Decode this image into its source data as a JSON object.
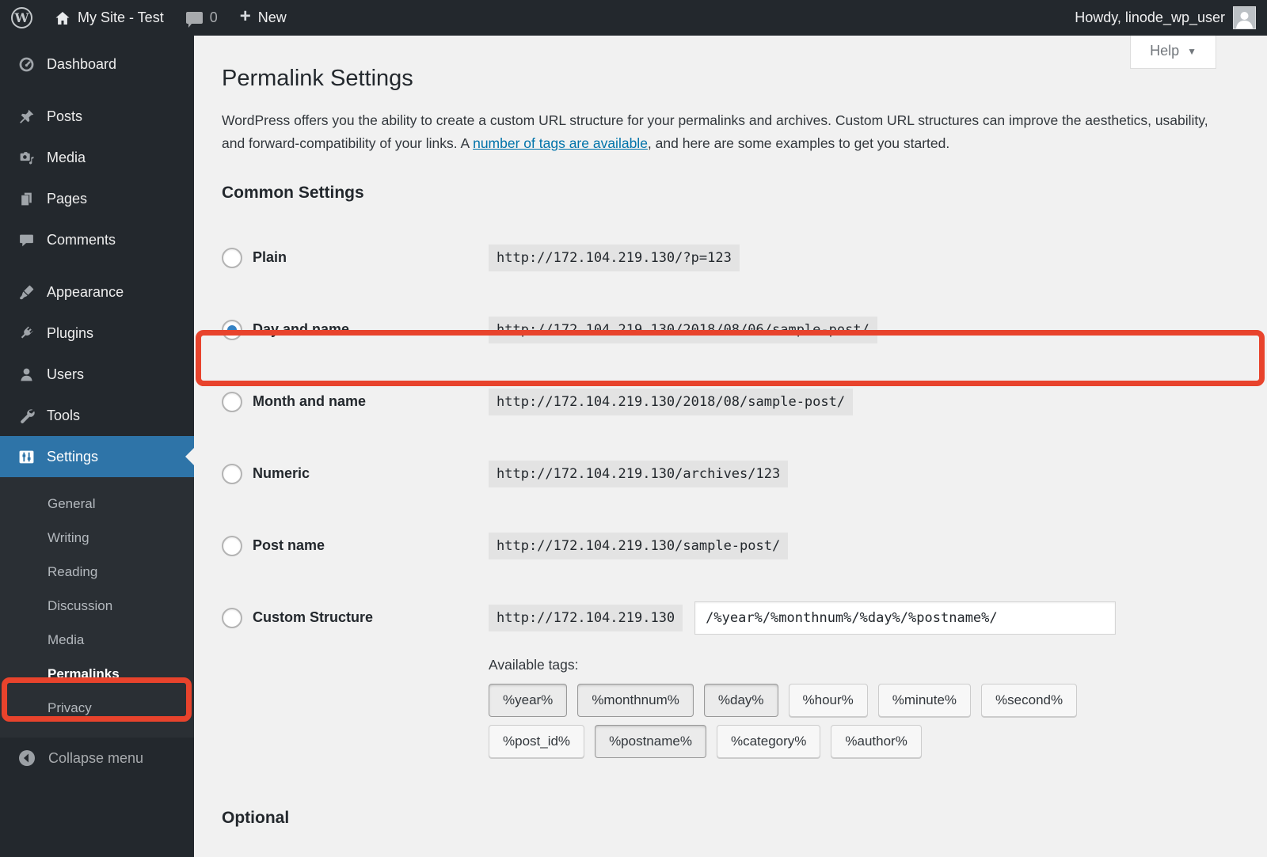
{
  "admin_bar": {
    "wp_logo_letter": "W",
    "site_name": "My Site - Test",
    "comment_count": "0",
    "new_label": "New",
    "howdy": "Howdy, linode_wp_user"
  },
  "sidebar": {
    "items": [
      "Dashboard",
      "Posts",
      "Media",
      "Pages",
      "Comments",
      "Appearance",
      "Plugins",
      "Users",
      "Tools",
      "Settings"
    ],
    "submenu": [
      "General",
      "Writing",
      "Reading",
      "Discussion",
      "Media",
      "Permalinks",
      "Privacy"
    ],
    "collapse_label": "Collapse menu"
  },
  "main": {
    "help_label": "Help",
    "title": "Permalink Settings",
    "intro_pre": "WordPress offers you the ability to create a custom URL structure for your permalinks and archives. Custom URL structures can improve the aesthetics, usability, and forward-compatibility of your links. A ",
    "intro_link": "number of tags are available",
    "intro_post": ", and here are some examples to get you started.",
    "common_heading": "Common Settings",
    "rows": [
      {
        "label": "Plain",
        "url": "http://172.104.219.130/?p=123"
      },
      {
        "label": "Day and name",
        "url": "http://172.104.219.130/2018/08/06/sample-post/"
      },
      {
        "label": "Month and name",
        "url": "http://172.104.219.130/2018/08/sample-post/"
      },
      {
        "label": "Numeric",
        "url": "http://172.104.219.130/archives/123"
      },
      {
        "label": "Post name",
        "url": "http://172.104.219.130/sample-post/"
      },
      {
        "label": "Custom Structure",
        "url_prefix": "http://172.104.219.130",
        "input_value": "/%year%/%monthnum%/%day%/%postname%/"
      }
    ],
    "available_tags_label": "Available tags:",
    "tags": [
      "%year%",
      "%monthnum%",
      "%day%",
      "%hour%",
      "%minute%",
      "%second%",
      "%post_id%",
      "%postname%",
      "%category%",
      "%author%"
    ],
    "optional_heading": "Optional"
  },
  "colors": {
    "accent_blue": "#2e74a8",
    "annotation_red": "#e8432c",
    "link_blue": "#0073aa",
    "sidebar_bg": "#23282d"
  }
}
